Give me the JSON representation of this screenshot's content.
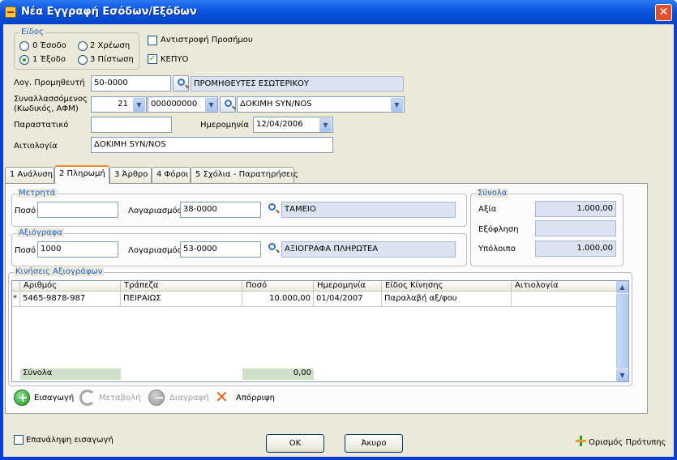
{
  "window": {
    "title": "Νέα Εγγραφή Εσόδων/Εξόδων"
  },
  "eidos": {
    "legend": "Είδος",
    "options": [
      "0 Έσοδο",
      "2 Χρέωση",
      "1 Έξοδο",
      "3 Πίστωση"
    ],
    "selected": "1 Έξοδο"
  },
  "flags": {
    "reverse_sign": "Αντιστροφή Προσήμου",
    "kepyo": "ΚΕΠΥΟ",
    "kepyo_checked": true,
    "reverse_checked": false
  },
  "form": {
    "supplier_label": "Λογ. Προμηθευτή",
    "supplier_code": "50-0000",
    "supplier_name": "ΠΡΟΜΗΘΕΥΤΕΣ ΕΣΩΤΕΡΙΚΟΥ",
    "party_label_1": "Συναλλασσόμενος",
    "party_label_2": "(Κωδικός, ΑΦΜ)",
    "party_code": "21",
    "party_afm": "000000000",
    "party_name": "ΔΟΚΙΜΗ SYN/NOS",
    "document_label": "Παραστατικό",
    "document_value": "",
    "date_label": "Ημερομηνία",
    "date_value": "12/04/2006",
    "reason_label": "Αιτιολογία",
    "reason_value": "ΔΟΚΙΜΗ SYN/NOS"
  },
  "tabs": [
    "1 Ανάλυση",
    "2 Πληρωμή",
    "3 Άρθρο",
    "4 Φόροι",
    "5 Σχόλια - Παρατηρήσεις"
  ],
  "cash": {
    "legend": "Μετρητά",
    "amount_label": "Ποσό",
    "amount_value": "",
    "account_label": "Λογαριασμός",
    "account_code": "38-0000",
    "account_name": "ΤΑΜΕΙΟ"
  },
  "cheques": {
    "legend": "Αξιόγραφα",
    "amount_label": "Ποσό",
    "amount_value": "1000",
    "account_label": "Λογαριασμός",
    "account_code": "53-0000",
    "account_name": "ΑΞΙΟΓΡΑΦΑ ΠΛΗΡΩΤΕΑ"
  },
  "totals": {
    "legend": "Σύνολα",
    "value_label": "Αξία",
    "value": "1.000,00",
    "settlement_label": "Εξόφληση",
    "settlement": "",
    "balance_label": "Υπόλοιπο",
    "balance": "1.000,00"
  },
  "movements": {
    "legend": "Κινήσεις Αξιογράφων",
    "columns": [
      "Αριθμός",
      "Τράπεζα",
      "Ποσό",
      "Ημερομηνία",
      "Είδος Κίνησης",
      "Αιτιολογία"
    ],
    "rows": [
      {
        "marker": "*",
        "number": "5465-9878-987",
        "bank": "ΠΕΙΡΑΙΩΣ",
        "amount": "10.000,00",
        "date": "01/04/2007",
        "type": "Παραλαβή αξ/φου",
        "reason": ""
      }
    ],
    "footer_label": "Σύνολα",
    "footer_amount": "0,00"
  },
  "actions": {
    "insert": "Εισαγωγή",
    "modify": "Μεταβολή",
    "delete": "Διαγραφή",
    "reject": "Απόρριψη"
  },
  "bottom": {
    "repeat": "Επανάληψη εισαγωγή",
    "ok": "OK",
    "cancel": "Άκυρο",
    "template": "Ορισμός Πρότυπης"
  },
  "colors": {
    "titlebar": "#0a56e0",
    "group_title": "#1c5fc8",
    "readonly_field": "#dbe2f0",
    "total_field": "#cfe0c8"
  }
}
